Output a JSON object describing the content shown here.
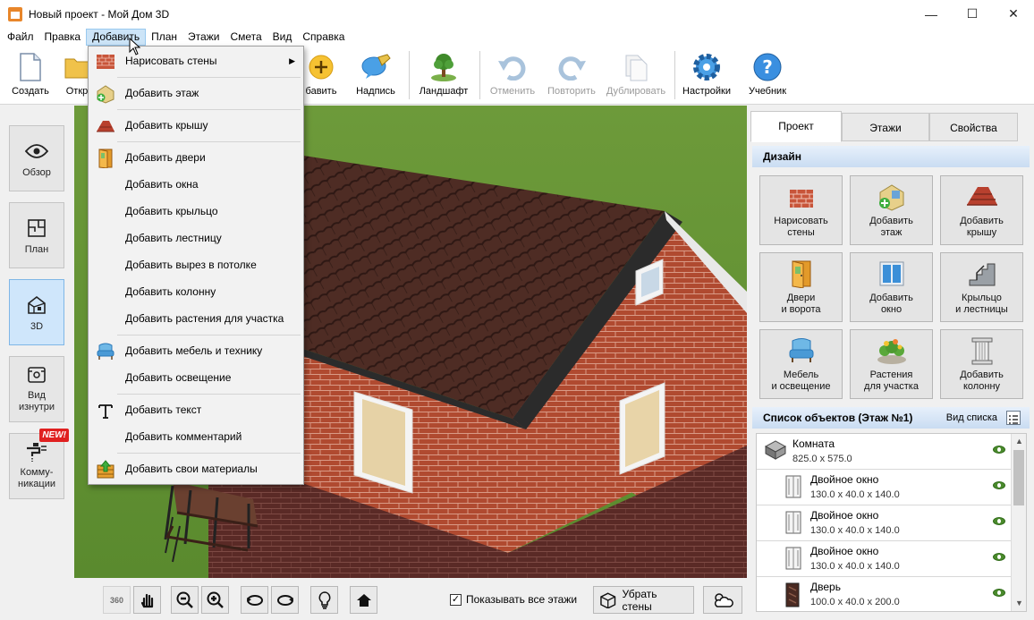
{
  "window": {
    "title": "Новый проект - Мой Дом 3D",
    "minimize": "—",
    "maximize": "☐",
    "close": "✕"
  },
  "menu": [
    "Файл",
    "Правка",
    "Добавить",
    "План",
    "Этажи",
    "Смета",
    "Вид",
    "Справка"
  ],
  "menu_active": "Добавить",
  "toolbar": {
    "create": "Создать",
    "open": "Откр",
    "add": "бавить",
    "label": "Надпись",
    "landscape": "Ландшафт",
    "undo": "Отменить",
    "redo": "Повторить",
    "duplicate": "Дублировать",
    "settings": "Настройки",
    "tutorial": "Учебник"
  },
  "left_panel": {
    "overview": "Обзор",
    "plan": "План",
    "view3d": "3D",
    "inside_1": "Вид",
    "inside_2": "изнутри",
    "comm_1": "Комму-",
    "comm_2": "никации",
    "new_badge": "NEW!"
  },
  "dropdown": [
    {
      "label": "Нарисовать стены",
      "icon": "brick-wall-icon",
      "submenu": true
    },
    {
      "label": "Добавить этаж",
      "icon": "add-floor-icon"
    },
    {
      "label": "Добавить крышу",
      "icon": "roof-icon"
    },
    {
      "label": "Добавить двери",
      "icon": "door-icon"
    },
    {
      "label": "Добавить окна",
      "icon": ""
    },
    {
      "label": "Добавить крыльцо",
      "icon": ""
    },
    {
      "label": "Добавить лестницу",
      "icon": ""
    },
    {
      "label": "Добавить вырез в потолке",
      "icon": ""
    },
    {
      "label": "Добавить колонну",
      "icon": ""
    },
    {
      "label": "Добавить растения для участка",
      "icon": ""
    },
    {
      "label": "Добавить мебель и технику",
      "icon": "armchair-icon"
    },
    {
      "label": "Добавить освещение",
      "icon": ""
    },
    {
      "label": "Добавить текст",
      "icon": "text-icon"
    },
    {
      "label": "Добавить комментарий",
      "icon": ""
    },
    {
      "label": "Добавить свои материалы",
      "icon": "materials-icon"
    }
  ],
  "bottom": {
    "show_all_floors": "Показывать все этажи",
    "hide_walls": "Убрать стены",
    "show_all_checked": true
  },
  "right_panel": {
    "tabs": [
      "Проект",
      "Этажи",
      "Свойства"
    ],
    "active_tab": "Проект",
    "design_title": "Дизайн",
    "design_buttons": [
      {
        "l1": "Нарисовать",
        "l2": "стены"
      },
      {
        "l1": "Добавить",
        "l2": "этаж"
      },
      {
        "l1": "Добавить",
        "l2": "крышу"
      },
      {
        "l1": "Двери",
        "l2": "и ворота"
      },
      {
        "l1": "Добавить",
        "l2": "окно"
      },
      {
        "l1": "Крыльцо",
        "l2": "и лестницы"
      },
      {
        "l1": "Мебель",
        "l2": "и освещение"
      },
      {
        "l1": "Растения",
        "l2": "для участка"
      },
      {
        "l1": "Добавить",
        "l2": "колонну"
      }
    ],
    "objects_title": "Список объектов (Этаж №1)",
    "list_view": "Вид списка",
    "objects": [
      {
        "name": "Комната",
        "dims": "825.0 x 575.0"
      },
      {
        "name": "Двойное окно",
        "dims": "130.0 x 40.0 x 140.0"
      },
      {
        "name": "Двойное окно",
        "dims": "130.0 x 40.0 x 140.0"
      },
      {
        "name": "Двойное окно",
        "dims": "130.0 x 40.0 x 140.0"
      },
      {
        "name": "Дверь",
        "dims": "100.0 x 40.0 x 200.0"
      }
    ]
  },
  "colors": {
    "grass": "#6f9a3e",
    "brick": "#b5482f",
    "roof": "#4a2a22",
    "accent_blue": "#2f7fd1"
  }
}
